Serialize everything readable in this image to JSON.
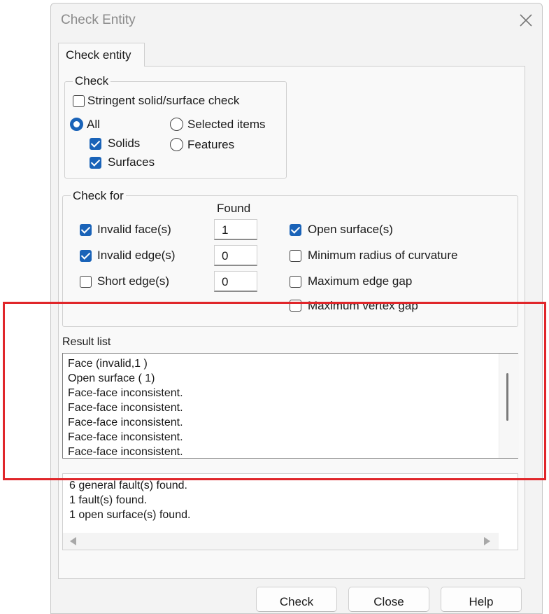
{
  "window": {
    "title": "Check Entity"
  },
  "tabs": [
    {
      "label": "Check entity"
    }
  ],
  "check_group": {
    "title": "Check",
    "stringent": {
      "label": "Stringent solid/surface check",
      "checked": false
    },
    "scope": {
      "all": {
        "label": "All",
        "selected": true
      },
      "selected_items": {
        "label": "Selected items",
        "selected": false
      },
      "features": {
        "label": "Features",
        "selected": false
      }
    },
    "solids": {
      "label": "Solids",
      "checked": true
    },
    "surfaces": {
      "label": "Surfaces",
      "checked": true
    }
  },
  "check_for_group": {
    "title": "Check for",
    "found_header": "Found",
    "items": [
      {
        "label": "Invalid face(s)",
        "checked": true,
        "found": "1"
      },
      {
        "label": "Invalid edge(s)",
        "checked": true,
        "found": "0"
      },
      {
        "label": "Short edge(s)",
        "checked": false,
        "found": "0"
      }
    ],
    "right_items": [
      {
        "label": "Open surface(s)",
        "checked": true
      },
      {
        "label": "Minimum radius of curvature",
        "checked": false
      },
      {
        "label": "Maximum edge gap",
        "checked": false
      },
      {
        "label": "Maximum vertex gap",
        "checked": false
      }
    ]
  },
  "result_list": {
    "label": "Result list",
    "lines": [
      "Face (invalid,1  )",
      "Open surface (  1)",
      "Face-face inconsistent.",
      "Face-face inconsistent.",
      "Face-face inconsistent.",
      "Face-face inconsistent.",
      "Face-face inconsistent."
    ]
  },
  "summary": {
    "lines": [
      "6 general fault(s) found.",
      "1 fault(s) found.",
      "1 open surface(s) found."
    ]
  },
  "buttons": {
    "check": "Check",
    "close": "Close",
    "help": "Help"
  },
  "colors": {
    "accent": "#1a63b8",
    "highlight_border": "#e0262a"
  }
}
